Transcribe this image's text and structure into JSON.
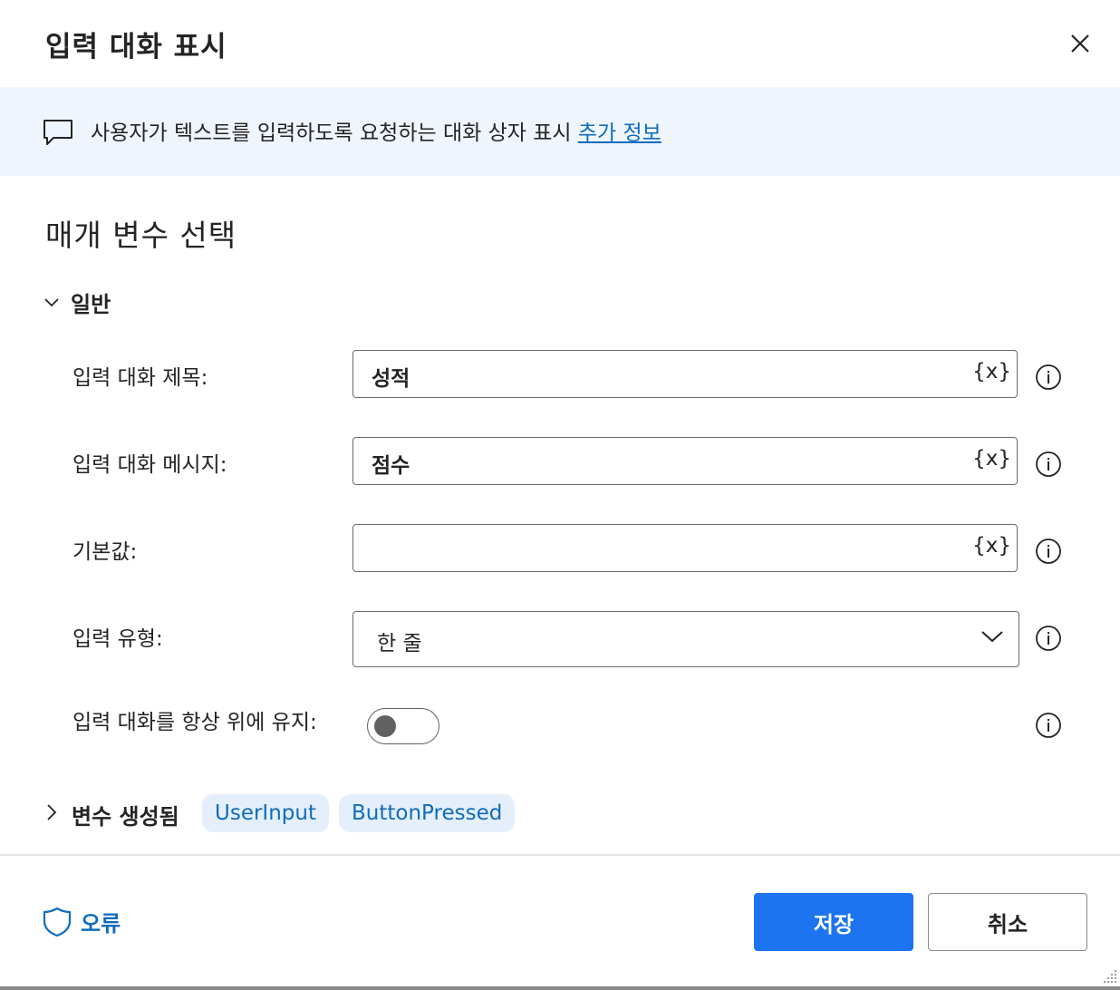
{
  "dialog": {
    "title": "입력 대화 표시",
    "close_icon": "close-icon"
  },
  "info": {
    "icon": "chat-icon",
    "text": "사용자가 텍스트를 입력하도록 요청하는 대화 상자 표시 ",
    "link": "추가 정보"
  },
  "section": {
    "title": "매개 변수 선택"
  },
  "general": {
    "label": "일반",
    "title_label": "입력 대화 제목:",
    "title_value": "성적",
    "message_label": "입력 대화 메시지:",
    "message_value": "점수",
    "default_label": "기본값:",
    "default_value": "",
    "type_label": "입력 유형:",
    "type_value": "한 줄",
    "topmost_label": "입력 대화를 항상 위에 유지:",
    "topmost_on": false,
    "var_token": "{x}"
  },
  "variables": {
    "label": "변수 생성됨",
    "chips": [
      "UserInput",
      "ButtonPressed"
    ]
  },
  "footer": {
    "error_label": "오류",
    "save_label": "저장",
    "cancel_label": "취소"
  },
  "colors": {
    "accent": "#1c74f0",
    "link": "#0f6cbd",
    "info_bg": "#eff5fc",
    "chip_bg": "#e5effb"
  }
}
